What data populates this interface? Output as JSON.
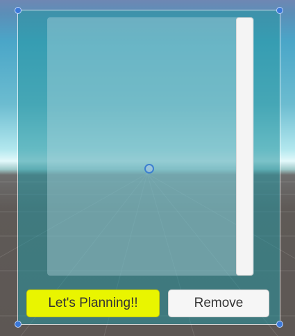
{
  "buttons": {
    "plan_label": "Let's Planning!!",
    "remove_label": "Remove"
  },
  "colors": {
    "plan_button": "#e9f500",
    "remove_button": "#f6f6f6",
    "panel": "#2696a0",
    "handle": "#3b78d8"
  },
  "icons": {
    "handles": "blue-circle-handle",
    "pivot": "pivot-ring"
  }
}
